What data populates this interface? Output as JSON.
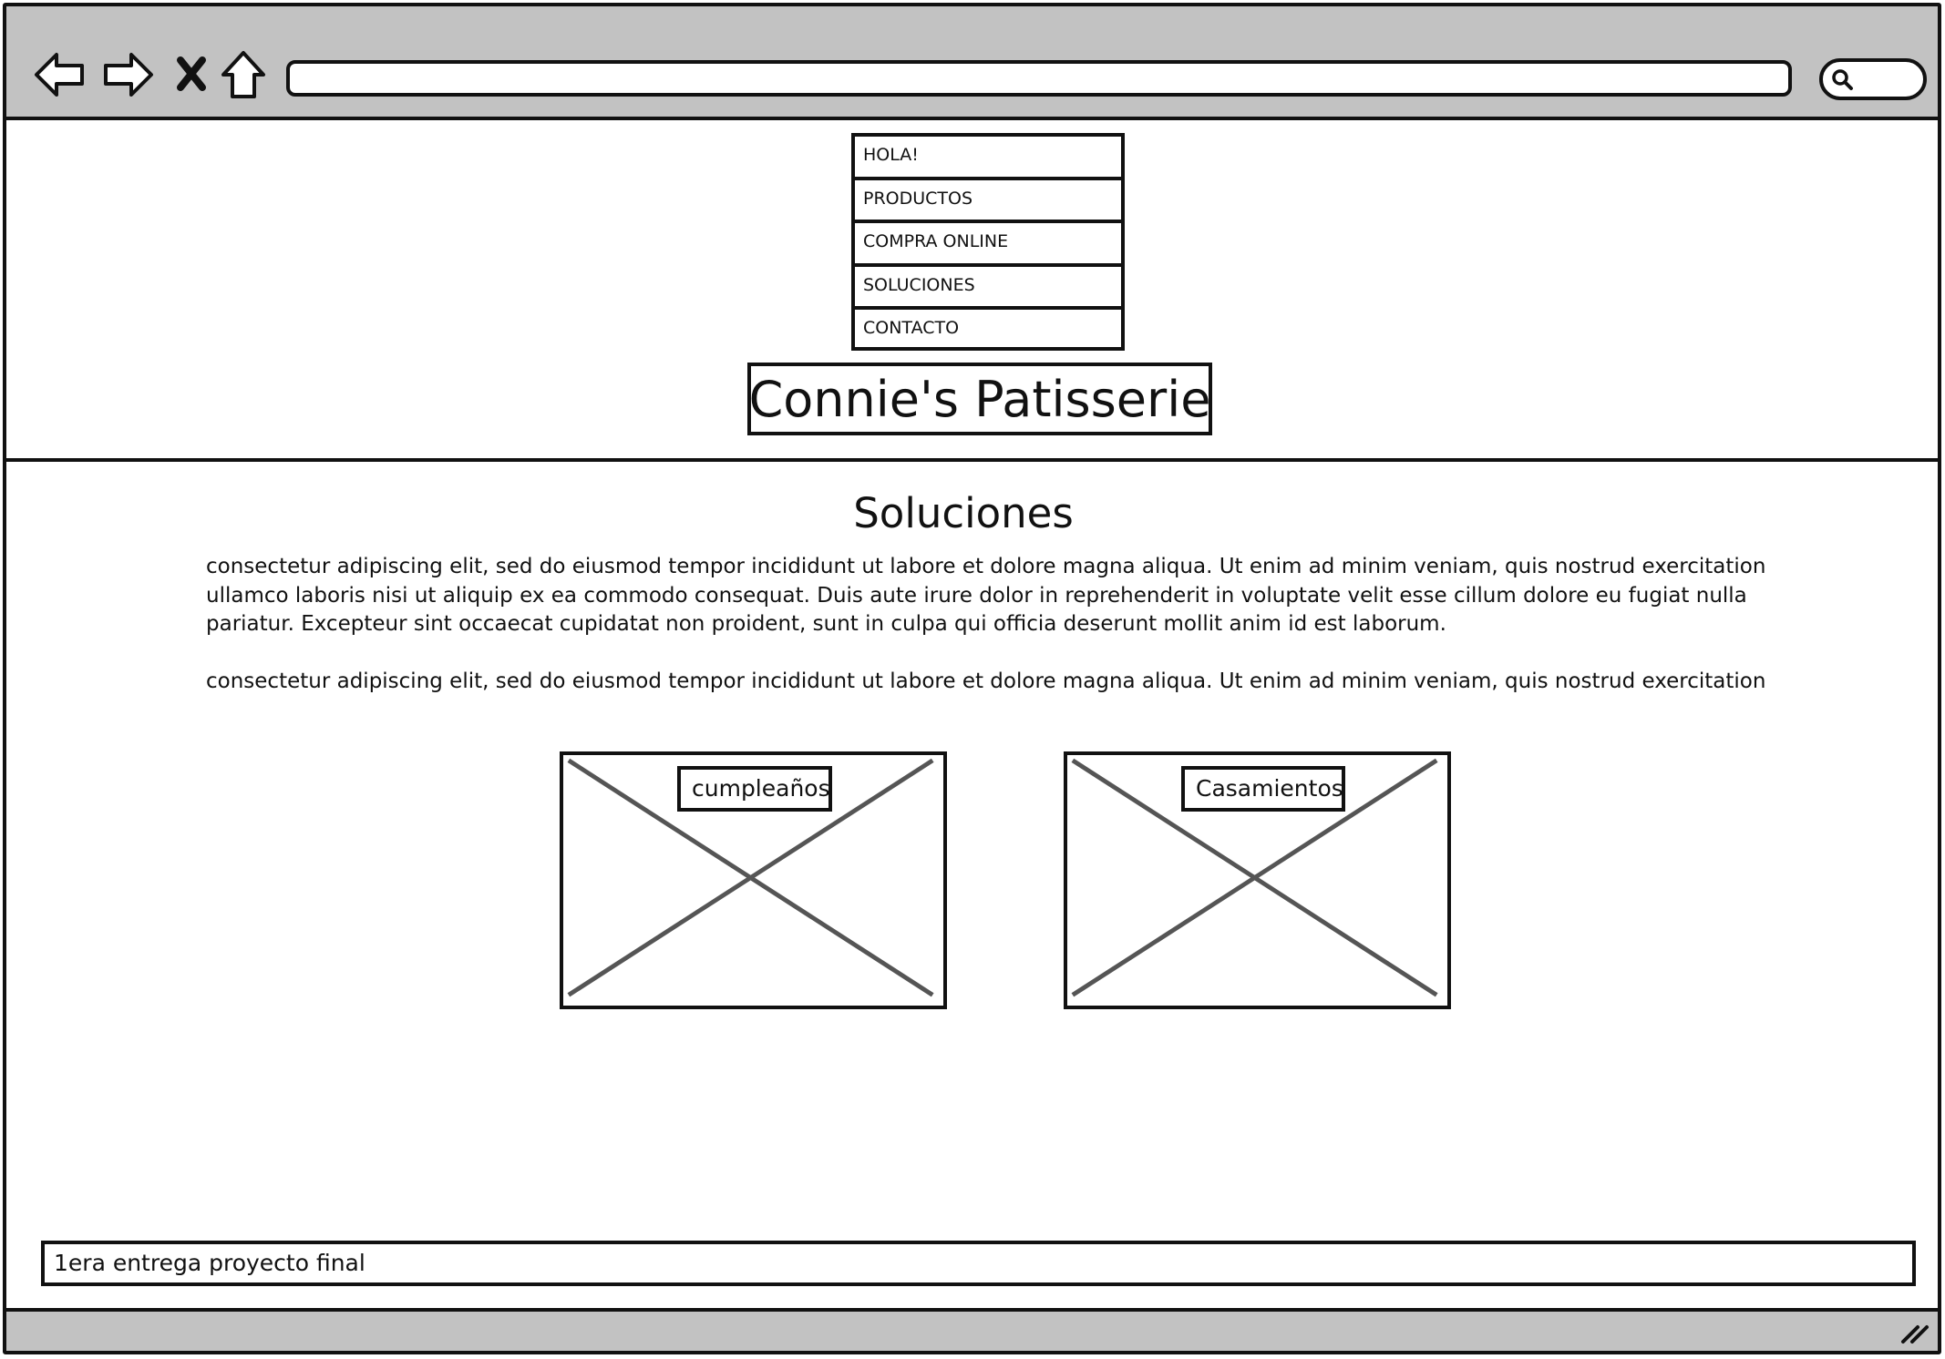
{
  "browser": {
    "icons": [
      "back-arrow-icon",
      "forward-arrow-icon",
      "stop-icon",
      "home-icon",
      "search-icon",
      "resize-grip-icon"
    ]
  },
  "menu": {
    "items": [
      {
        "label": "HOLA!"
      },
      {
        "label": "PRODUCTOS"
      },
      {
        "label": "COMPRA ONLINE"
      },
      {
        "label": "SOLUCIONES"
      },
      {
        "label": "CONTACTO"
      }
    ]
  },
  "logo": "Connie's Patisserie",
  "section": {
    "title": "Soluciones",
    "paragraphs": [
      "consectetur adipiscing elit, sed do eiusmod tempor incididunt ut labore et dolore magna aliqua. Ut enim ad minim veniam, quis nostrud exercitation ullamco laboris nisi ut aliquip ex ea commodo consequat. Duis aute irure dolor in reprehenderit in voluptate velit esse cillum dolore eu fugiat nulla pariatur. Excepteur sint occaecat cupidatat non proident, sunt in culpa qui officia deserunt mollit anim id est laborum.",
      "consectetur adipiscing elit, sed do eiusmod tempor incididunt ut labore et dolore magna aliqua. Ut enim ad minim veniam, quis nostrud exercitation"
    ]
  },
  "cards": [
    {
      "label": "cumpleaños"
    },
    {
      "label": "Casamientos"
    }
  ],
  "footer": "1era entrega proyecto final",
  "colors": {
    "chrome": "#c2c2c2",
    "stroke": "#111111",
    "placeholder_cross": "#555555"
  }
}
